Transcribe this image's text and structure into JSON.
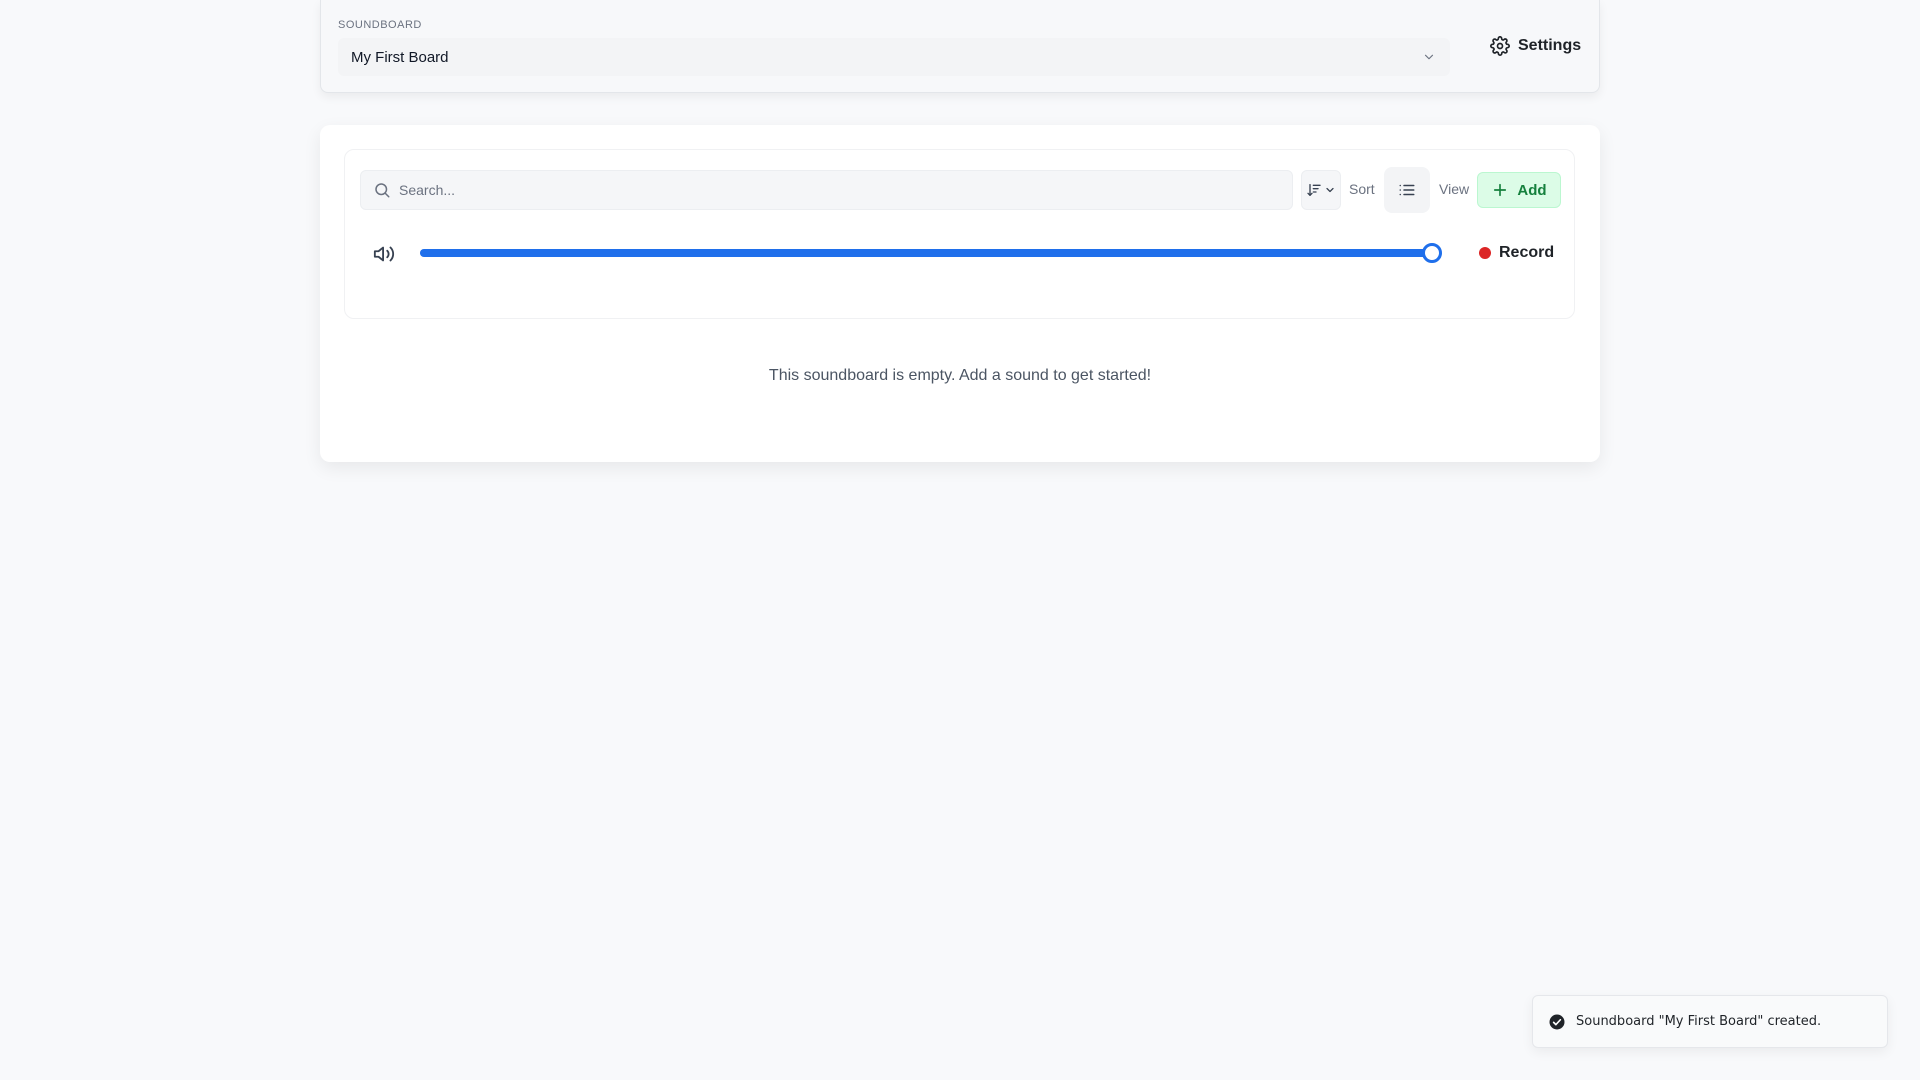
{
  "header": {
    "soundboard_label": "SOUNDBOARD",
    "selected_board": "My First Board",
    "settings_label": "Settings"
  },
  "toolbar": {
    "search_placeholder": "Search...",
    "sort_label": "Sort",
    "view_label": "View",
    "add_label": "Add"
  },
  "player": {
    "volume_fraction": 1.0,
    "record_label": "Record"
  },
  "main": {
    "empty_message": "This soundboard is empty. Add a sound to get started!"
  },
  "toast": {
    "message": "Soundboard \"My First Board\" created."
  },
  "icons": {
    "settings": "gear-icon",
    "search": "search-icon",
    "sort": "sort-icon",
    "view": "list-icon",
    "add": "plus-icon",
    "volume": "speaker-icon",
    "toast": "check-circle-icon"
  },
  "colors": {
    "accent": "#1f6feb",
    "record": "#dc2626",
    "add_bg": "#dcfce7",
    "add_text": "#15803d"
  }
}
